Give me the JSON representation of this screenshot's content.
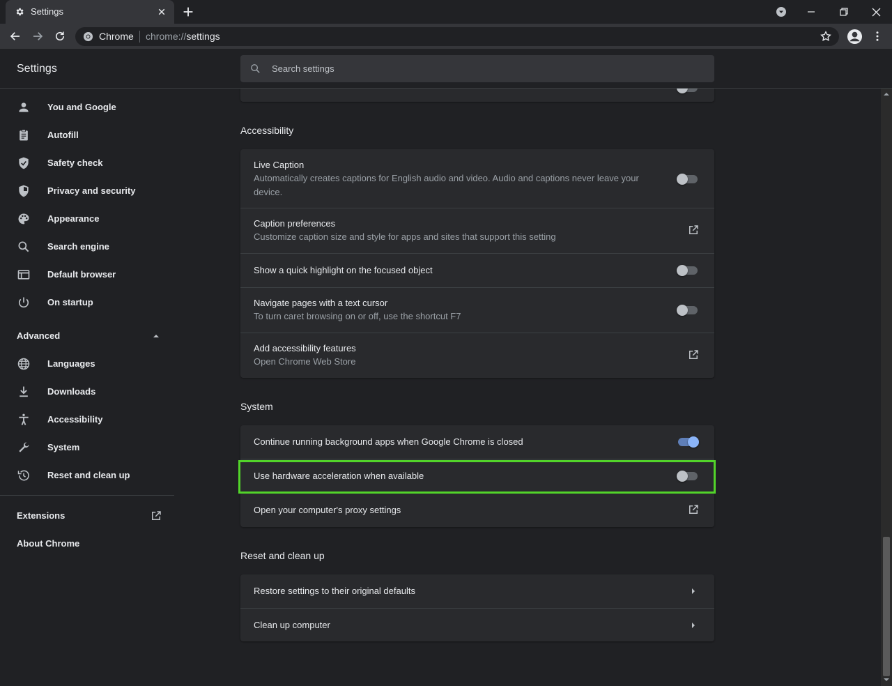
{
  "browser": {
    "tab_title": "Settings",
    "omnibox_label": "Chrome",
    "url_scheme": "chrome://",
    "url_host": "settings"
  },
  "header": {
    "title": "Settings",
    "search_placeholder": "Search settings"
  },
  "sidebar": {
    "items": [
      {
        "label": "You and Google",
        "icon": "person-icon"
      },
      {
        "label": "Autofill",
        "icon": "clipboard-icon"
      },
      {
        "label": "Safety check",
        "icon": "shield-check-icon"
      },
      {
        "label": "Privacy and security",
        "icon": "shield-icon"
      },
      {
        "label": "Appearance",
        "icon": "palette-icon"
      },
      {
        "label": "Search engine",
        "icon": "search-icon"
      },
      {
        "label": "Default browser",
        "icon": "browser-icon"
      },
      {
        "label": "On startup",
        "icon": "power-icon"
      }
    ],
    "advanced_label": "Advanced",
    "advanced_items": [
      {
        "label": "Languages",
        "icon": "globe-icon"
      },
      {
        "label": "Downloads",
        "icon": "download-icon"
      },
      {
        "label": "Accessibility",
        "icon": "accessibility-icon"
      },
      {
        "label": "System",
        "icon": "wrench-icon"
      },
      {
        "label": "Reset and clean up",
        "icon": "history-icon"
      }
    ],
    "extensions_label": "Extensions",
    "about_label": "About Chrome"
  },
  "accessibility": {
    "title": "Accessibility",
    "rows": [
      {
        "title": "Live Caption",
        "subtitle": "Automatically creates captions for English audio and video. Audio and captions never leave your device.",
        "control": "toggle",
        "on": false
      },
      {
        "title": "Caption preferences",
        "subtitle": "Customize caption size and style for apps and sites that support this setting",
        "control": "open"
      },
      {
        "title": "Show a quick highlight on the focused object",
        "control": "toggle",
        "on": false
      },
      {
        "title": "Navigate pages with a text cursor",
        "subtitle": "To turn caret browsing on or off, use the shortcut F7",
        "control": "toggle",
        "on": false
      },
      {
        "title": "Add accessibility features",
        "subtitle": "Open Chrome Web Store",
        "control": "open"
      }
    ]
  },
  "system": {
    "title": "System",
    "rows": [
      {
        "title": "Continue running background apps when Google Chrome is closed",
        "control": "toggle",
        "on": true
      },
      {
        "title": "Use hardware acceleration when available",
        "control": "toggle",
        "on": false
      },
      {
        "title": "Open your computer's proxy settings",
        "control": "open"
      }
    ]
  },
  "reset": {
    "title": "Reset and clean up",
    "rows": [
      {
        "title": "Restore settings to their original defaults",
        "control": "chevron"
      },
      {
        "title": "Clean up computer",
        "control": "chevron"
      }
    ]
  },
  "colors": {
    "background": "#202124",
    "card": "#292a2d",
    "toggle_on": "#8ab4f8",
    "highlight": "#52d42a"
  }
}
